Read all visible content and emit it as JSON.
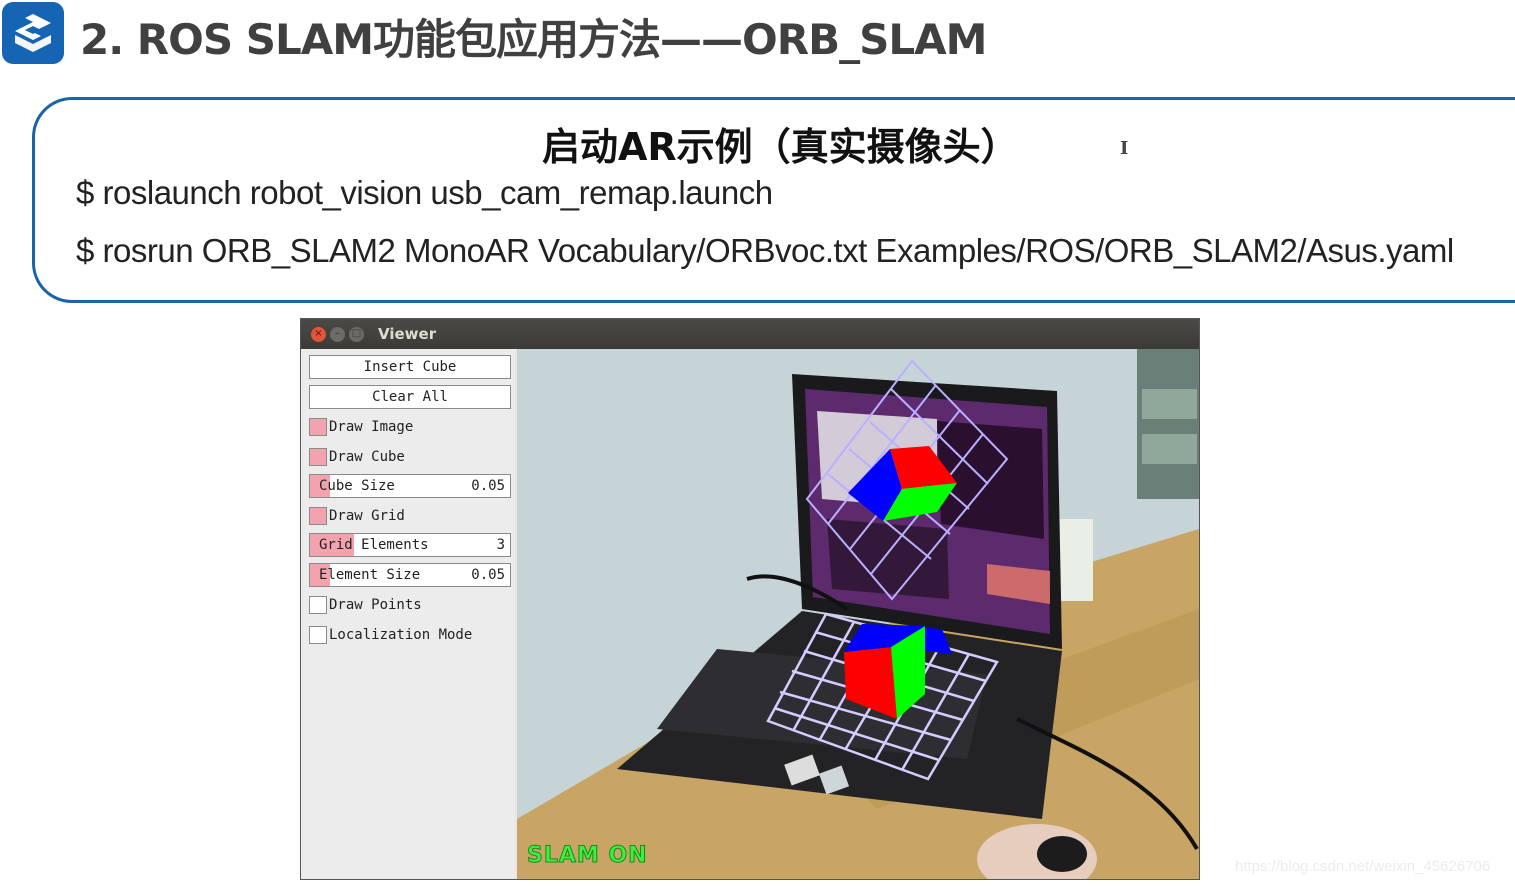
{
  "header": {
    "logo_icon": "s-logo-icon",
    "title": "2. ROS SLAM功能包应用方法——ORB_SLAM"
  },
  "command_box": {
    "title": "启动AR示例（真实摄像头）",
    "commands": [
      "$ roslaunch robot_vision usb_cam_remap.launch",
      "$ rosrun ORB_SLAM2 MonoAR Vocabulary/ORBvoc.txt Examples/ROS/ORB_SLAM2/Asus.yaml"
    ],
    "cursor_glyph": "I"
  },
  "viewer": {
    "window_title": "Viewer",
    "window_buttons": {
      "close": "×",
      "minimize": "–",
      "maximize": "□"
    },
    "panel": {
      "insert_cube_label": "Insert Cube",
      "clear_all_label": "Clear All",
      "draw_image": {
        "label": "Draw Image",
        "checked": true
      },
      "draw_cube": {
        "label": "Draw Cube",
        "checked": true
      },
      "cube_size": {
        "label": "Cube Size",
        "value": "0.05",
        "fraction": 0.1
      },
      "draw_grid": {
        "label": "Draw Grid",
        "checked": true
      },
      "grid_elements": {
        "label": "Grid Elements",
        "value": "3",
        "fraction": 0.22
      },
      "element_size": {
        "label": "Element Size",
        "value": "0.05",
        "fraction": 0.1
      },
      "draw_points": {
        "label": "Draw Points",
        "checked": false
      },
      "localization_mode": {
        "label": "Localization Mode",
        "checked": false
      }
    },
    "camera": {
      "slam_status": "SLAM ON",
      "colors": {
        "cube_red": "#ff0000",
        "cube_green": "#00ff00",
        "cube_blue": "#0000ff",
        "grid": "#c8c0ff",
        "slam_text": "#3df03d"
      }
    }
  },
  "watermark": "https://blog.csdn.net/weixin_45626706"
}
